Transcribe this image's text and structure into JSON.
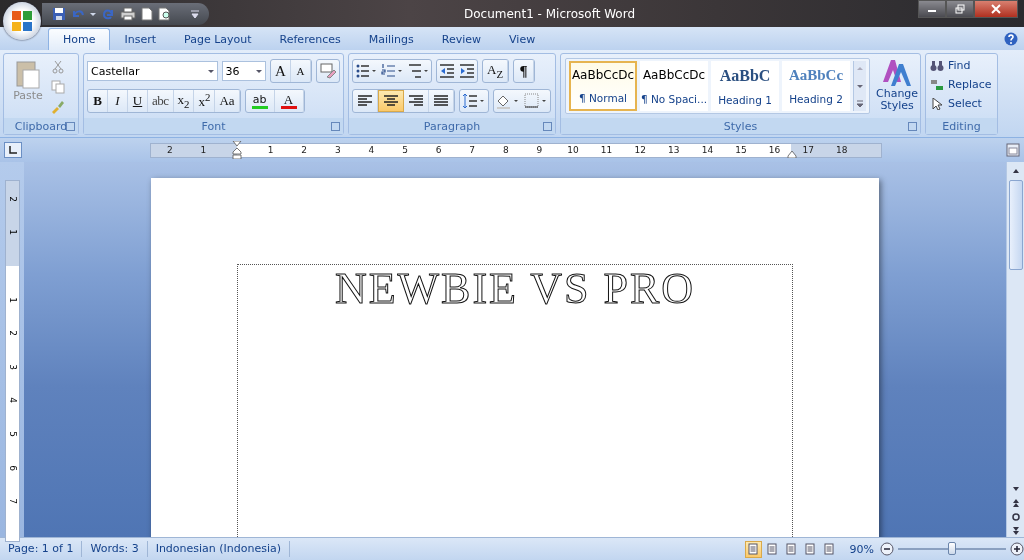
{
  "window": {
    "title": "Document1 - Microsoft Word"
  },
  "tabs": [
    {
      "label": "Home",
      "selected": true
    },
    {
      "label": "Insert",
      "selected": false
    },
    {
      "label": "Page Layout",
      "selected": false
    },
    {
      "label": "References",
      "selected": false
    },
    {
      "label": "Mailings",
      "selected": false
    },
    {
      "label": "Review",
      "selected": false
    },
    {
      "label": "View",
      "selected": false
    }
  ],
  "clipboard": {
    "paste": "Paste",
    "group": "Clipboard"
  },
  "font": {
    "group": "Font",
    "family": "Castellar",
    "size": "36",
    "grow": "A",
    "shrink": "A",
    "format_buttons": [
      {
        "label": "B",
        "kind": "bold"
      },
      {
        "label": "I",
        "kind": "italic"
      },
      {
        "label": "U",
        "kind": "underline"
      },
      {
        "label": "abc",
        "kind": "strike"
      },
      {
        "label": "x$_{2}$",
        "kind": "plain"
      },
      {
        "label": "x$^{2}$",
        "kind": "plain"
      },
      {
        "label": "Aa",
        "kind": "plain"
      }
    ],
    "highlight": {
      "label": "ab",
      "color": "#22cc22"
    },
    "font_color": {
      "label": "A",
      "color": "#e01010"
    }
  },
  "paragraph": {
    "group": "Paragraph",
    "show_marks": "¶",
    "sort": "A$_{Z}$",
    "alignment": [
      {
        "kind": "left",
        "selected": false
      },
      {
        "kind": "center",
        "selected": true
      },
      {
        "kind": "right",
        "selected": false
      },
      {
        "kind": "justify",
        "selected": false
      }
    ]
  },
  "styles": {
    "group": "Styles",
    "change_styles": "Change Styles",
    "gallery": [
      {
        "sample": "AaBbCcDc",
        "name": "¶ Normal",
        "kind": "normal",
        "selected": true
      },
      {
        "sample": "AaBbCcDc",
        "name": "¶ No Spaci...",
        "kind": "normal",
        "selected": false
      },
      {
        "sample": "AaBbC",
        "name": "Heading 1",
        "kind": "heading1",
        "selected": false
      },
      {
        "sample": "AaBbCc",
        "name": "Heading 2",
        "kind": "heading2",
        "selected": false
      }
    ]
  },
  "editing": {
    "group": "Editing",
    "find": "Find",
    "replace": "Replace",
    "select": "Select"
  },
  "ruler": {
    "horizontal": [
      "2",
      "1",
      "1",
      "2",
      "3",
      "4",
      "5",
      "6",
      "7",
      "8",
      "9",
      "10",
      "11",
      "12",
      "13",
      "14",
      "15",
      "16",
      "17",
      "18"
    ],
    "vertical": [
      "2",
      "1",
      "1",
      "2",
      "3",
      "4",
      "5",
      "6",
      "7"
    ]
  },
  "document": {
    "text": "NEWBIE VS PRO"
  },
  "status_bar": {
    "page": "Page: 1 of 1",
    "words": "Words: 3",
    "language": "Indonesian (Indonesia)",
    "zoom": "90%",
    "zoom_slider": {
      "level": 0.5
    },
    "views": [
      {
        "selected": true
      },
      {
        "selected": false
      },
      {
        "selected": false
      },
      {
        "selected": false
      },
      {
        "selected": false
      }
    ]
  }
}
